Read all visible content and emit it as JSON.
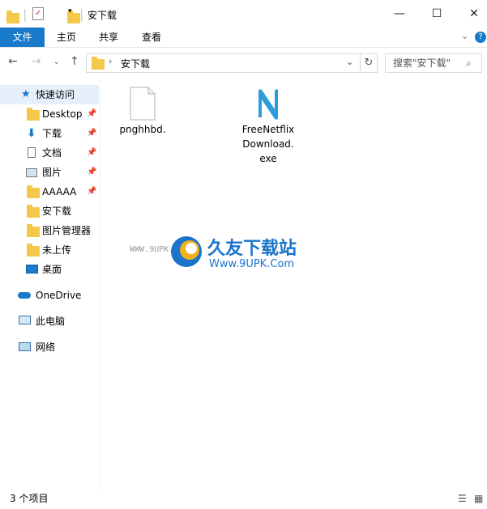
{
  "window": {
    "title": "安下载"
  },
  "ribbon": {
    "tabs": [
      "文件",
      "主页",
      "共享",
      "查看"
    ]
  },
  "address": {
    "path": "安下载",
    "search_placeholder": "搜索\"安下载\""
  },
  "sidebar": {
    "quick_access": "快速访问",
    "items": [
      {
        "label": "Desktop",
        "pinned": true
      },
      {
        "label": "下载",
        "pinned": true
      },
      {
        "label": "文档",
        "pinned": true
      },
      {
        "label": "图片",
        "pinned": true
      },
      {
        "label": "AAAAA",
        "pinned": true
      },
      {
        "label": "安下载",
        "pinned": false
      },
      {
        "label": "图片管理器",
        "pinned": false
      },
      {
        "label": "未上传",
        "pinned": false
      },
      {
        "label": "桌面",
        "pinned": false
      }
    ],
    "onedrive": "OneDrive",
    "this_pc": "此电脑",
    "network": "网络"
  },
  "files": [
    {
      "name": "pnghhbd.",
      "icon": "blank-file-icon"
    },
    {
      "name": "FreeNetflix Download. exe",
      "lines": [
        "FreeNetflix",
        "Download.",
        "exe"
      ],
      "icon": "app-n-icon"
    }
  ],
  "watermark": {
    "site": "久友下载站",
    "url": "Www.9UPK.Com",
    "left": "WWW.9UPK.COM"
  },
  "status": {
    "item_count": "3 个项目"
  },
  "colors": {
    "accent": "#1979ca",
    "folder": "#f3c84b"
  }
}
